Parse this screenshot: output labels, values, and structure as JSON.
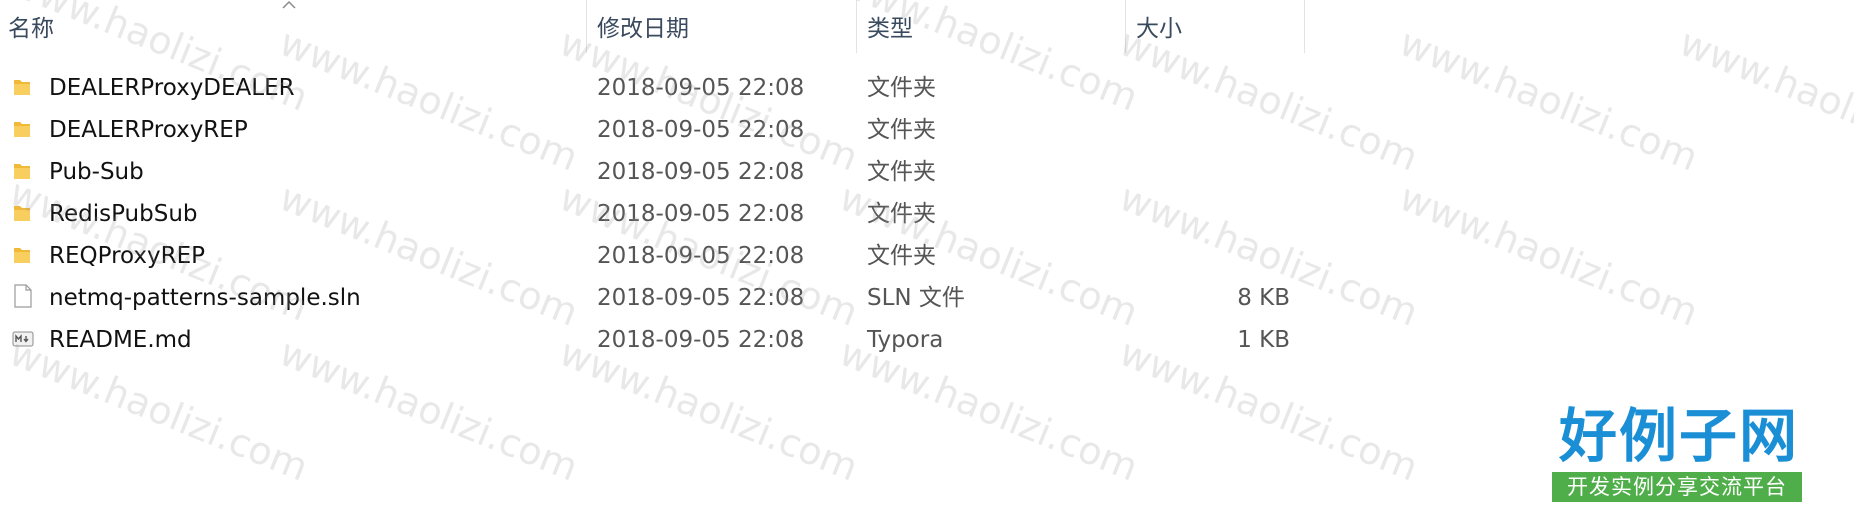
{
  "columns": {
    "name": "名称",
    "modified": "修改日期",
    "type": "类型",
    "size": "大小"
  },
  "files": [
    {
      "icon": "folder-icon",
      "name": "DEALERProxyDEALER",
      "modified": "2018-09-05 22:08",
      "type": "文件夹",
      "size": ""
    },
    {
      "icon": "folder-icon",
      "name": "DEALERProxyREP",
      "modified": "2018-09-05 22:08",
      "type": "文件夹",
      "size": ""
    },
    {
      "icon": "folder-icon",
      "name": "Pub-Sub",
      "modified": "2018-09-05 22:08",
      "type": "文件夹",
      "size": ""
    },
    {
      "icon": "folder-icon",
      "name": "RedisPubSub",
      "modified": "2018-09-05 22:08",
      "type": "文件夹",
      "size": ""
    },
    {
      "icon": "folder-icon",
      "name": "REQProxyREP",
      "modified": "2018-09-05 22:08",
      "type": "文件夹",
      "size": ""
    },
    {
      "icon": "file-icon",
      "name": "netmq-patterns-sample.sln",
      "modified": "2018-09-05 22:08",
      "type": "SLN 文件",
      "size": "8 KB"
    },
    {
      "icon": "markdown-file-icon",
      "name": "README.md",
      "modified": "2018-09-05 22:08",
      "type": "Typora",
      "size": "1 KB"
    }
  ],
  "watermark": {
    "text": "www.haolizi.com"
  },
  "logo": {
    "main": "好例子网",
    "sub": "开发实例分享交流平台"
  },
  "colors": {
    "header_text": "#3a4a5e",
    "folder": "#f5c451",
    "logo_blue": "#1a8fd6",
    "logo_green": "#4fae4a"
  }
}
